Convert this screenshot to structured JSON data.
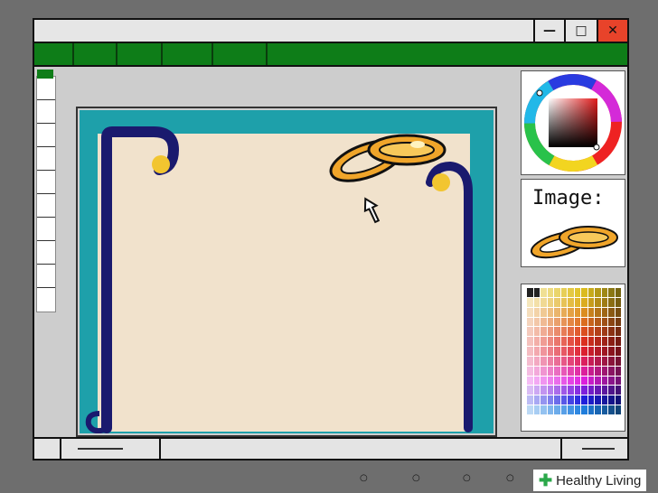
{
  "window": {
    "controls": {
      "minimize": "—",
      "maximize": "□",
      "close": "✕"
    }
  },
  "menubar": {
    "items": [
      "",
      "",
      "",
      "",
      "",
      ""
    ]
  },
  "right_panel": {
    "image_label": "Image:"
  },
  "colors": {
    "menubar": "#0e7d18",
    "close": "#e8432a",
    "teal": "#1ea0aa",
    "paper": "#f1e2cc",
    "navy": "#1a1a6e",
    "gold": "#f0a52a"
  },
  "watermark": {
    "brand": "Healthy Living"
  }
}
